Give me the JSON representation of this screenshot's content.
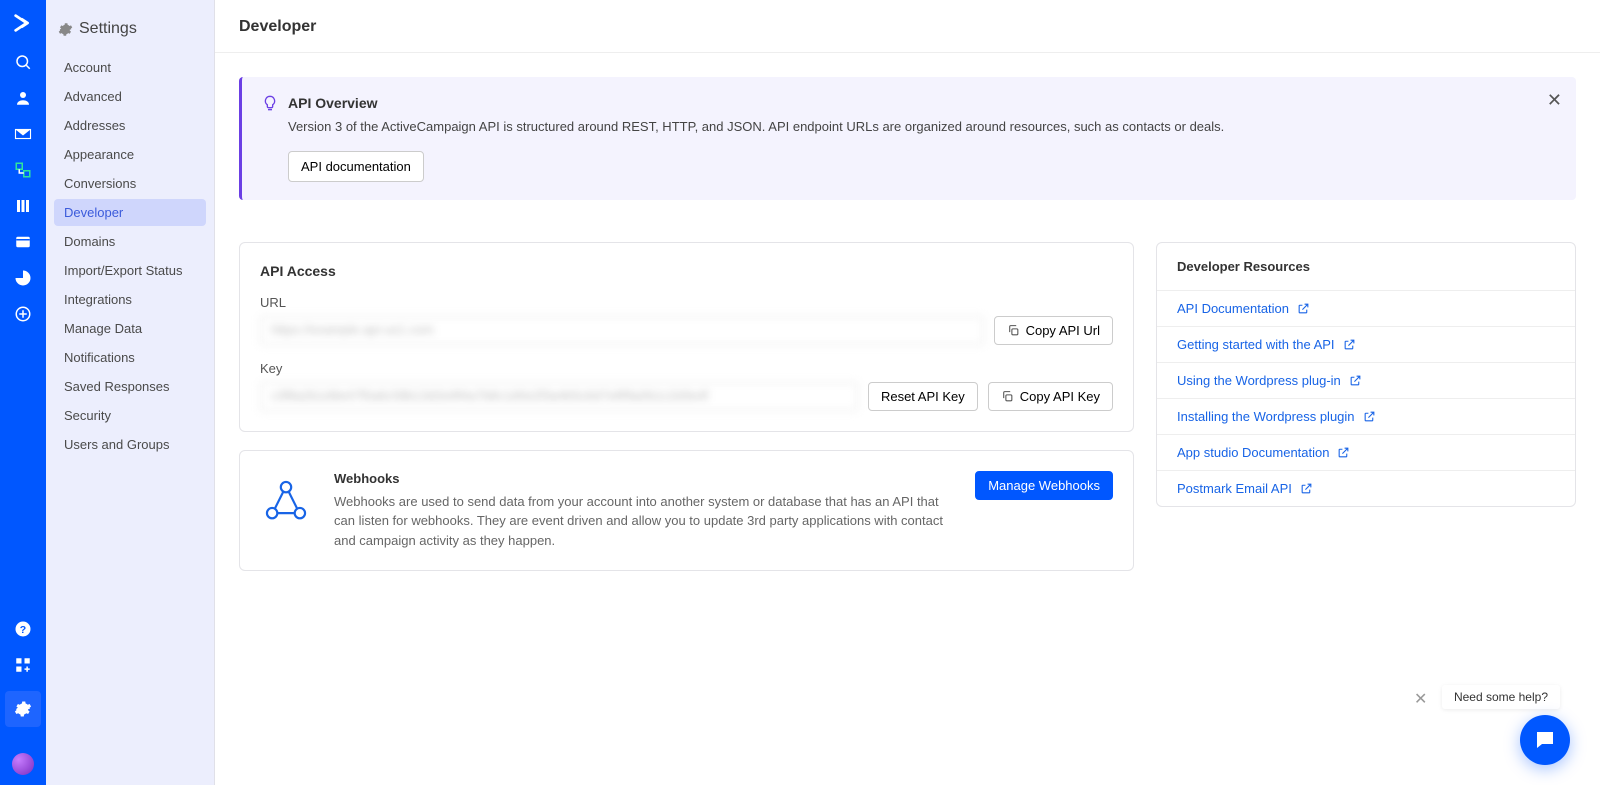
{
  "settings": {
    "header": "Settings",
    "items": [
      {
        "label": "Account"
      },
      {
        "label": "Advanced"
      },
      {
        "label": "Addresses"
      },
      {
        "label": "Appearance"
      },
      {
        "label": "Conversions"
      },
      {
        "label": "Developer",
        "active": true
      },
      {
        "label": "Domains"
      },
      {
        "label": "Import/Export Status"
      },
      {
        "label": "Integrations"
      },
      {
        "label": "Manage Data"
      },
      {
        "label": "Notifications"
      },
      {
        "label": "Saved Responses"
      },
      {
        "label": "Security"
      },
      {
        "label": "Users and Groups"
      }
    ]
  },
  "page": {
    "title": "Developer"
  },
  "banner": {
    "title": "API Overview",
    "desc": "Version 3 of the ActiveCampaign API is structured around REST, HTTP, and JSON. API endpoint URLs are organized around resources, such as contacts or deals.",
    "button": "API documentation"
  },
  "api": {
    "access_title": "API Access",
    "url_label": "URL",
    "url_value": "https://example.api-us1.com",
    "copy_url": "Copy API Url",
    "key_label": "Key",
    "key_value": "c3f8a2b1d9e47f0a6c58b13d2e9f4a7b8c1d0e2f3a4b5c6d7e8f9a0b1c2d3e4f",
    "reset_key": "Reset API Key",
    "copy_key": "Copy API Key"
  },
  "webhooks": {
    "title": "Webhooks",
    "desc": "Webhooks are used to send data from your account into another system or database that has an API that can listen for webhooks. They are event driven and allow you to update 3rd party applications with contact and campaign activity as they happen.",
    "button": "Manage Webhooks"
  },
  "resources": {
    "title": "Developer Resources",
    "items": [
      {
        "label": "API Documentation"
      },
      {
        "label": "Getting started with the API"
      },
      {
        "label": "Using the Wordpress plug-in"
      },
      {
        "label": "Installing the Wordpress plugin"
      },
      {
        "label": "App studio Documentation"
      },
      {
        "label": "Postmark Email API"
      }
    ]
  },
  "help": {
    "tip": "Need some help?"
  }
}
